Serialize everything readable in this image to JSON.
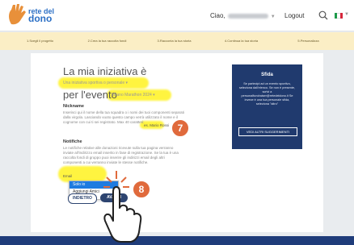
{
  "header": {
    "logo_line1": "rete del",
    "logo_line2": "dono",
    "greeting": "Ciao,",
    "logout": "Logout",
    "search_icon": "search-icon",
    "language_icon": "italian-flag-icon"
  },
  "steps": [
    "1.Scegli il progetto",
    "2.Crea la tua raccolta fondi",
    "3.Racconta la tua storia",
    "4.Continua la tua storia",
    "5.Personalizza"
  ],
  "form": {
    "title": "La mia iniziativa è",
    "initiative_value": "Una iniziativa sportiva o personale",
    "per_label": "per l'evento",
    "event_value": "Milano Marathon 2024",
    "nickname_label": "Nickname",
    "nickname_desc": "Inserisci qui il nome della tua squadra o i nomi dei tuoi componenti separati dalla virgola. Lasciando vuoto questo campo verrà utilizzato il nome e il cognome con cui ti sei registrato. Max 40 caratteri:",
    "nickname_example": "es. Mario Rossi",
    "notifiche_label": "Notifiche",
    "notifiche_desc": "Le notifiche relative alle donazioni ricevute sulla tua pagina verranno inviate all'indirizzo email inserito in fase di registrazione. Se la tua è una raccolta fondi di gruppo puoi inserire gli indirizzi email degli altri componenti a cui verranno inviate le stesse notifiche.",
    "notifiche_option_prefix": "Email",
    "dropdown_options": [
      "Solo io",
      "Aggiungi Amici"
    ],
    "btn_back": "INDIETRO",
    "btn_next": "AVANTI"
  },
  "sidebar": {
    "title": "Sfida",
    "text": "Se partecipi ad un evento sportivo, seleziona dall'elenco. Se non è presente, scrivi a personalfundraiser@retedeldono.it Se invece è una tua personale sfida, seleziona \"altro\"",
    "button": "VEDI ALTRI SUGGERIMENTI"
  },
  "annotations": {
    "badge_7": "7",
    "badge_8": "8"
  },
  "colors": {
    "accent_blue": "#203a6e",
    "highlight": "#fff000",
    "badge": "#e06a3c",
    "steps_bg": "#fbeec5"
  }
}
